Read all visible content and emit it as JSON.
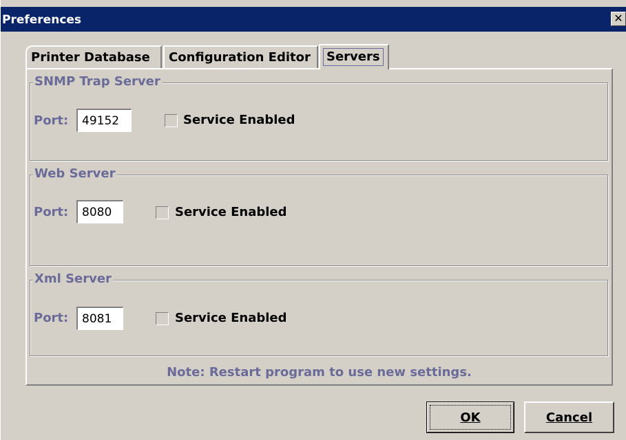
{
  "window": {
    "title": "Preferences",
    "close_glyph": "✕"
  },
  "tabs": [
    {
      "label": "Printer Database",
      "selected": false
    },
    {
      "label": "Configuration Editor",
      "selected": false
    },
    {
      "label": "Servers",
      "selected": true
    }
  ],
  "servers": [
    {
      "legend": "SNMP Trap Server",
      "port_label": "Port:",
      "port": "49152",
      "service_label": "Service Enabled",
      "enabled": false
    },
    {
      "legend": "Web Server",
      "port_label": "Port:",
      "port": "8080",
      "service_label": "Service Enabled",
      "enabled": false
    },
    {
      "legend": "Xml Server",
      "port_label": "Port:",
      "port": "8081",
      "service_label": "Service Enabled",
      "enabled": false
    }
  ],
  "note": "Note: Restart program to use new settings.",
  "buttons": {
    "ok_label": "OK",
    "cancel_label": "Cancel"
  },
  "colors": {
    "titlebar": "#0a246a",
    "label_blue": "#6b6b9a",
    "face": "#d4d0c8"
  }
}
